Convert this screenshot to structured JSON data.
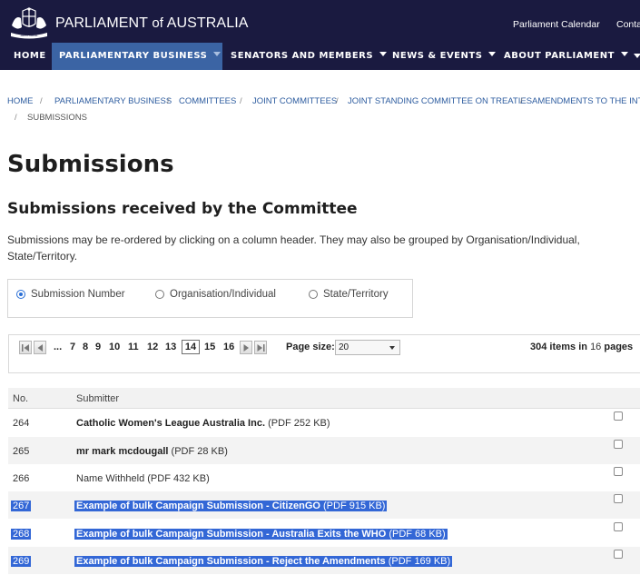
{
  "header": {
    "site_title_main": "PARLIAMENT",
    "site_title_of": "of",
    "site_title_end": "AUSTRALIA",
    "crest_alt_text": "AUSTRALIA",
    "util_links": [
      "Parliament Calendar",
      "Conta"
    ]
  },
  "nav": {
    "items": [
      {
        "label": "HOME",
        "dropdown": false,
        "active": false
      },
      {
        "label": "PARLIAMENTARY BUSINESS",
        "dropdown": true,
        "active": true
      },
      {
        "label": "SENATORS AND MEMBERS",
        "dropdown": true,
        "active": false
      },
      {
        "label": "NEWS & EVENTS",
        "dropdown": true,
        "active": false
      },
      {
        "label": "ABOUT PARLIAMENT",
        "dropdown": true,
        "active": false
      }
    ]
  },
  "breadcrumb": {
    "items": [
      "HOME",
      "PARLIAMENTARY BUSINESS",
      "COMMITTEES",
      "JOINT COMMITTEES",
      "JOINT STANDING COMMITTEE ON TREATIES",
      "AMENDMENTS TO THE INTER"
    ],
    "current": "SUBMISSIONS",
    "separator": "/"
  },
  "page": {
    "title": "Submissions",
    "section_title": "Submissions received by the Committee",
    "intro": "Submissions may be re-ordered by clicking on a column header. They may also be grouped by Organisation/Individual, State/Territory."
  },
  "grouping": {
    "options": [
      {
        "label": "Submission Number",
        "selected": true
      },
      {
        "label": "Organisation/Individual",
        "selected": false
      },
      {
        "label": "State/Territory",
        "selected": false
      }
    ]
  },
  "pager": {
    "ellipsis": "...",
    "pages": [
      "7",
      "8",
      "9",
      "10",
      "11",
      "12",
      "13",
      "14",
      "15",
      "16"
    ],
    "current_page": "14",
    "page_size_label": "Page size:",
    "page_size_value": "20",
    "total_items": "304",
    "items_in_label": "items in",
    "total_pages": "16",
    "pages_label": "pages"
  },
  "table": {
    "columns": [
      "No.",
      "Submitter"
    ],
    "rows": [
      {
        "no": "264",
        "name": "Catholic Women's League Australia Inc.",
        "size": "(PDF 252 KB)",
        "bold": true,
        "selected": false
      },
      {
        "no": "265",
        "name": "mr mark mcdougall",
        "size": "(PDF 28 KB)",
        "bold": true,
        "selected": false
      },
      {
        "no": "266",
        "name": "Name Withheld",
        "size": "(PDF 432 KB)",
        "bold": false,
        "selected": false
      },
      {
        "no": "267",
        "name": "Example of bulk Campaign Submission - CitizenGO",
        "size": "(PDF 915 KB)",
        "bold": true,
        "selected": true
      },
      {
        "no": "268",
        "name": "Example of bulk Campaign Submission - Australia Exits the WHO",
        "size": "(PDF 68 KB)",
        "bold": true,
        "selected": true
      },
      {
        "no": "269",
        "name": "Example of bulk Campaign Submission - Reject the Amendments",
        "size": "(PDF 169 KB)",
        "bold": true,
        "selected": true
      }
    ]
  },
  "colors": {
    "header_bg": "#1a1a40",
    "active_nav_bg": "#3b64a4",
    "link": "#2d5c9f",
    "selection": "#3367d6"
  }
}
